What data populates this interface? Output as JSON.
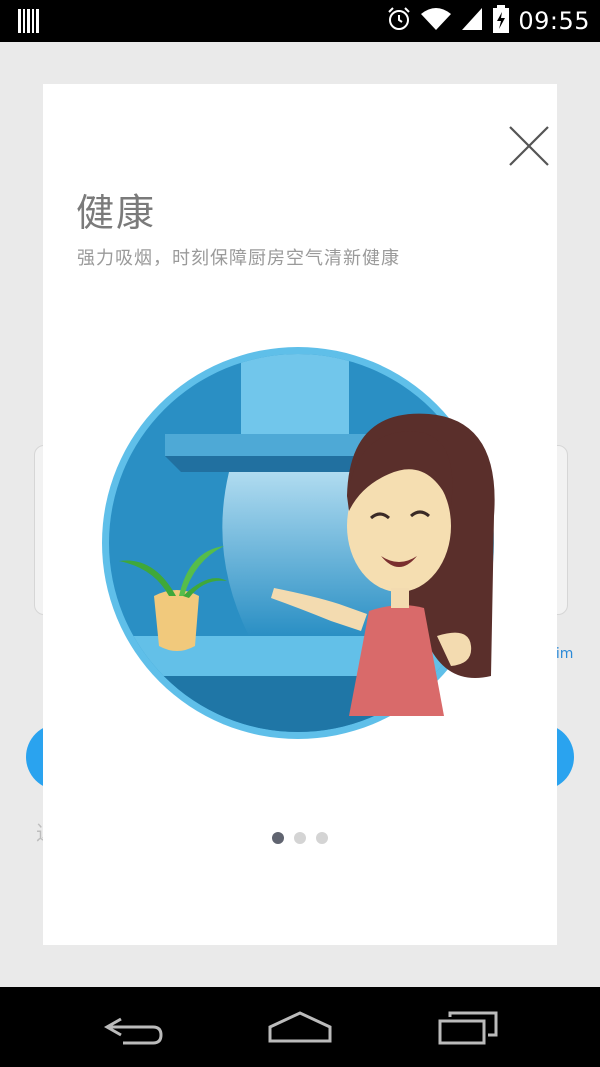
{
  "status_bar": {
    "time": "09:55",
    "icons": [
      "barcode-icon",
      "alarm-icon",
      "wifi-icon",
      "signal-icon",
      "battery-charging-icon"
    ]
  },
  "modal": {
    "title": "健康",
    "subtitle": "强力吸烟，时刻保障厨房空气清新健康",
    "close_icon": "close-icon",
    "illustration": "kitchen-range-hood-illustration",
    "pager": {
      "total": 3,
      "active_index": 0
    }
  },
  "background": {
    "left_char": "近",
    "right_char": "lim"
  },
  "nav_bar": {
    "icons": [
      "back-icon",
      "home-icon",
      "recents-icon"
    ]
  },
  "colors": {
    "circle_blue": "#2a8fc4",
    "circle_rim": "#5fbfe9",
    "hood_light": "#71c6eb",
    "dot_active": "#606470",
    "dot_inactive": "#d4d4d4"
  }
}
